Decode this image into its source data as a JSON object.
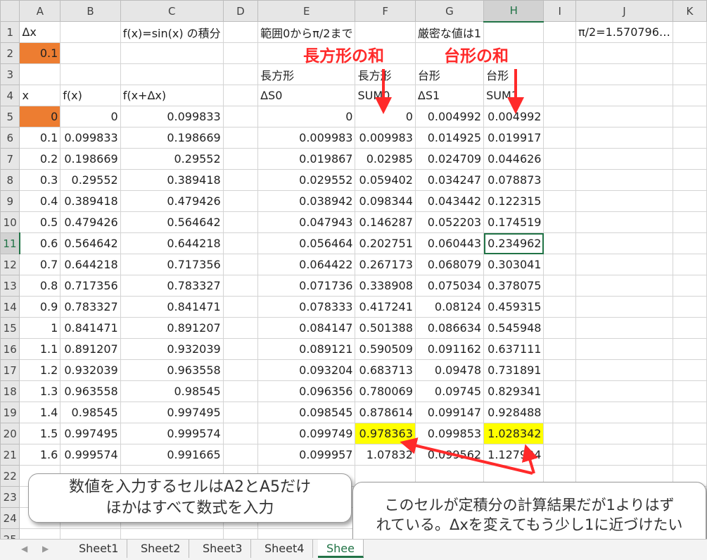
{
  "columns": [
    "A",
    "B",
    "C",
    "D",
    "E",
    "F",
    "G",
    "H",
    "I",
    "J",
    "K"
  ],
  "rows": [
    [
      "Δx",
      "",
      "f(x)=sin(x) の積分",
      "",
      "範囲0からπ/2まで",
      "",
      "厳密な値は1",
      "",
      "",
      "π/2=1.570796…",
      ""
    ],
    [
      "0.1",
      "",
      "",
      "",
      "",
      "",
      "",
      "",
      "",
      "",
      ""
    ],
    [
      "",
      "",
      "",
      "",
      "長方形",
      "長方形",
      "台形",
      "台形",
      "",
      "",
      ""
    ],
    [
      "x",
      "f(x)",
      "f(x+Δx)",
      "",
      "ΔS0",
      "SUM0",
      "ΔS1",
      "SUM1",
      "",
      "",
      ""
    ],
    [
      "0",
      "0",
      "0.099833",
      "",
      "0",
      "0",
      "0.004992",
      "0.004992",
      "",
      "",
      ""
    ],
    [
      "0.1",
      "0.099833",
      "0.198669",
      "",
      "0.009983",
      "0.009983",
      "0.014925",
      "0.019917",
      "",
      "",
      ""
    ],
    [
      "0.2",
      "0.198669",
      "0.29552",
      "",
      "0.019867",
      "0.02985",
      "0.024709",
      "0.044626",
      "",
      "",
      ""
    ],
    [
      "0.3",
      "0.29552",
      "0.389418",
      "",
      "0.029552",
      "0.059402",
      "0.034247",
      "0.078873",
      "",
      "",
      ""
    ],
    [
      "0.4",
      "0.389418",
      "0.479426",
      "",
      "0.038942",
      "0.098344",
      "0.043442",
      "0.122315",
      "",
      "",
      ""
    ],
    [
      "0.5",
      "0.479426",
      "0.564642",
      "",
      "0.047943",
      "0.146287",
      "0.052203",
      "0.174519",
      "",
      "",
      ""
    ],
    [
      "0.6",
      "0.564642",
      "0.644218",
      "",
      "0.056464",
      "0.202751",
      "0.060443",
      "0.234962",
      "",
      "",
      ""
    ],
    [
      "0.7",
      "0.644218",
      "0.717356",
      "",
      "0.064422",
      "0.267173",
      "0.068079",
      "0.303041",
      "",
      "",
      ""
    ],
    [
      "0.8",
      "0.717356",
      "0.783327",
      "",
      "0.071736",
      "0.338908",
      "0.075034",
      "0.378075",
      "",
      "",
      ""
    ],
    [
      "0.9",
      "0.783327",
      "0.841471",
      "",
      "0.078333",
      "0.417241",
      "0.08124",
      "0.459315",
      "",
      "",
      ""
    ],
    [
      "1",
      "0.841471",
      "0.891207",
      "",
      "0.084147",
      "0.501388",
      "0.086634",
      "0.545948",
      "",
      "",
      ""
    ],
    [
      "1.1",
      "0.891207",
      "0.932039",
      "",
      "0.089121",
      "0.590509",
      "0.091162",
      "0.637111",
      "",
      "",
      ""
    ],
    [
      "1.2",
      "0.932039",
      "0.963558",
      "",
      "0.093204",
      "0.683713",
      "0.09478",
      "0.731891",
      "",
      "",
      ""
    ],
    [
      "1.3",
      "0.963558",
      "0.98545",
      "",
      "0.096356",
      "0.780069",
      "0.09745",
      "0.829341",
      "",
      "",
      ""
    ],
    [
      "1.4",
      "0.98545",
      "0.997495",
      "",
      "0.098545",
      "0.878614",
      "0.099147",
      "0.928488",
      "",
      "",
      ""
    ],
    [
      "1.5",
      "0.997495",
      "0.999574",
      "",
      "0.099749",
      "0.978363",
      "0.099853",
      "1.028342",
      "",
      "",
      ""
    ],
    [
      "1.6",
      "0.999574",
      "0.991665",
      "",
      "0.099957",
      "1.07832",
      "0.099562",
      "1.127904",
      "",
      "",
      ""
    ],
    [
      "",
      "",
      "",
      "",
      "",
      "",
      "",
      "",
      "",
      "",
      ""
    ],
    [
      "",
      "",
      "",
      "",
      "",
      "",
      "",
      "",
      "",
      "",
      ""
    ],
    [
      "",
      "",
      "",
      "",
      "",
      "",
      "",
      "",
      "",
      "",
      ""
    ],
    [
      "",
      "",
      "",
      "",
      "",
      "",
      "",
      "",
      "",
      "",
      ""
    ]
  ],
  "annotations": {
    "rect_sum_label": "長方形の和",
    "trap_sum_label": "台形の和",
    "note_left_line1": "数値を入力するセルはA2とA5だけ",
    "note_left_line2": "ほかはすべて数式を入力",
    "note_right_line1": "このセルが定積分の計算結果だが1よりはず",
    "note_right_line2": "れている。Δxを変えてもう少し1に近づけたい"
  },
  "sheet_tabs": [
    "Sheet1",
    "Sheet2",
    "Sheet3",
    "Sheet4",
    "Shee"
  ],
  "active_tab": "Shee",
  "selected_cell": "H11",
  "colors": {
    "input_cell": "#ed7d31",
    "highlight": "#ffff00",
    "annotation_red": "#ff2a2a",
    "excel_green": "#217346"
  }
}
